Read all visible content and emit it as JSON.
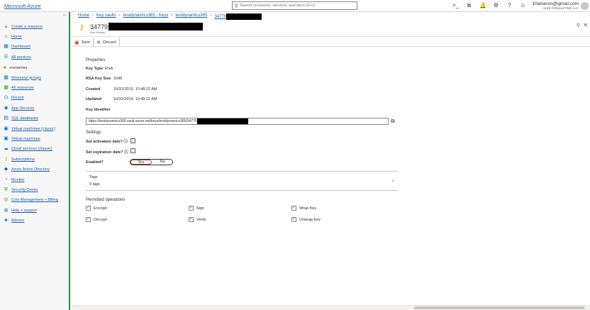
{
  "topbar": {
    "brand": "Microsoft Azure",
    "search_placeholder": "Search resources, services, and docs (G+/)",
    "icons": [
      "cloud-shell-icon",
      "directory-filter-icon",
      "notifications-icon",
      "settings-icon",
      "help-icon",
      "feedback-icon"
    ],
    "icon_glyphs": [
      ">_",
      "⧉",
      "🔔",
      "⚙",
      "?",
      "☺"
    ],
    "account_email": "10ameron@gmail.com",
    "account_org": "UIS5 CONSULTING LLC"
  },
  "sidebar": {
    "collapse": "«",
    "create": "Create a resource",
    "home": "Home",
    "dashboard": "Dashboard",
    "all_services": "All services",
    "favorites": "FAVORITES",
    "items": [
      {
        "label": "Resource groups",
        "icon": "resource-groups-icon",
        "glyph": "▦",
        "color": "#0078d4"
      },
      {
        "label": "All resources",
        "icon": "all-resources-icon",
        "glyph": "▦",
        "color": "#3a9d23"
      },
      {
        "label": "Recent",
        "icon": "recent-icon",
        "glyph": "◷",
        "color": "#0078d4"
      },
      {
        "label": "App Services",
        "icon": "app-services-icon",
        "glyph": "◉",
        "color": "#0078d4"
      },
      {
        "label": "SQL databases",
        "icon": "sql-databases-icon",
        "glyph": "▤",
        "color": "#0078d4"
      },
      {
        "label": "Virtual machines (classic)",
        "icon": "vm-classic-icon",
        "glyph": "▣",
        "color": "#0078d4"
      },
      {
        "label": "Virtual machines",
        "icon": "virtual-machines-icon",
        "glyph": "▣",
        "color": "#0078d4"
      },
      {
        "label": "Cloud services (classic)",
        "icon": "cloud-services-icon",
        "glyph": "☁",
        "color": "#0078d4"
      },
      {
        "label": "Subscriptions",
        "icon": "subscriptions-icon",
        "glyph": "⚷",
        "color": "#e6b800"
      },
      {
        "label": "Azure Active Directory",
        "icon": "active-directory-icon",
        "glyph": "◆",
        "color": "#0078d4"
      },
      {
        "label": "Monitor",
        "icon": "monitor-icon",
        "glyph": "◔",
        "color": "#0078d4"
      },
      {
        "label": "Security Center",
        "icon": "security-center-icon",
        "glyph": "⛨",
        "color": "#3a9d23"
      },
      {
        "label": "Cost Management + Billing",
        "icon": "cost-management-icon",
        "glyph": "◎",
        "color": "#3a9d23"
      },
      {
        "label": "Help + support",
        "icon": "help-support-icon",
        "glyph": "◍",
        "color": "#0078d4"
      },
      {
        "label": "Advisor",
        "icon": "advisor-icon",
        "glyph": "◈",
        "color": "#0078d4"
      }
    ]
  },
  "breadcrumb": {
    "home": "Home",
    "key_vaults": "Key vaults",
    "vault_keys": "testdynamics365 - Keys",
    "vault": "testdynamics365",
    "key": "34779"
  },
  "header": {
    "title": "34779",
    "subtitle": "Key Version"
  },
  "toolbar": {
    "save": "Save",
    "discard": "Discard"
  },
  "properties": {
    "section": "Properties",
    "key_type_label": "Key Type",
    "key_type_value": "RSA",
    "key_size_label": "RSA Key Size",
    "key_size_value": "2048",
    "created_label": "Created",
    "created_value": "10/31/2019, 10:48:22 AM",
    "updated_label": "Updated",
    "updated_value": "10/31/2019, 10:48:22 AM",
    "identifier_label": "Key Identifier",
    "identifier_value": "https://testdynamics365.vault.azure.net/keys/testdynamics365/34779"
  },
  "settings": {
    "section": "Settings",
    "activation_label": "Set activation date?",
    "expiration_label": "Set expiration date?",
    "enabled_label": "Enabled?",
    "yes": "Yes",
    "no": "No",
    "enabled": true
  },
  "tags": {
    "label": "Tags",
    "value": "0 tags"
  },
  "permitted": {
    "section": "Permitted operations",
    "ops": [
      {
        "label": "Encrypt",
        "checked": true
      },
      {
        "label": "Sign",
        "checked": true
      },
      {
        "label": "Wrap Key",
        "checked": true
      },
      {
        "label": "Decrypt",
        "checked": true
      },
      {
        "label": "Verify",
        "checked": true
      },
      {
        "label": "Unwrap Key",
        "checked": true
      }
    ]
  },
  "colors": {
    "link": "#1b5fa8",
    "sidebar_border": "#1e8f4a",
    "save_icon": "#c0392b",
    "key_icon": "#e6b800"
  }
}
